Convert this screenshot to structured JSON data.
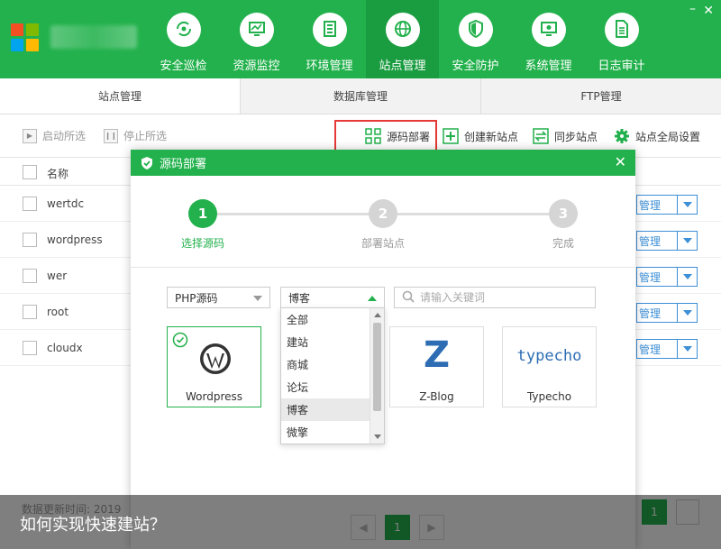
{
  "window": {
    "minimize_glyph": "–",
    "close_glyph": "✕"
  },
  "nav": [
    {
      "label": "安全巡检",
      "icon": "refresh-eye-icon"
    },
    {
      "label": "资源监控",
      "icon": "monitor-chart-icon"
    },
    {
      "label": "环境管理",
      "icon": "server-icon"
    },
    {
      "label": "站点管理",
      "icon": "globe-icon",
      "active": true
    },
    {
      "label": "安全防护",
      "icon": "shield-icon"
    },
    {
      "label": "系统管理",
      "icon": "settings-monitor-icon"
    },
    {
      "label": "日志审计",
      "icon": "document-icon"
    }
  ],
  "tabs": [
    "站点管理",
    "数据库管理",
    "FTP管理"
  ],
  "toolbar": {
    "start_selected": "启动所选",
    "stop_selected": "停止所选",
    "deploy_source": "源码部署",
    "create_site": "创建新站点",
    "sync_sites": "同步站点",
    "global_settings": "站点全局设置"
  },
  "table": {
    "header_name": "名称",
    "rows": [
      "wertdc",
      "wordpress",
      "wer",
      "root",
      "cloudx"
    ],
    "manage_label": "管理"
  },
  "footer": {
    "update_time": "数据更新时间: 2019",
    "page": "1"
  },
  "dialog": {
    "title": "源码部署",
    "close_glyph": "✕",
    "steps": [
      {
        "num": "1",
        "label": "选择源码"
      },
      {
        "num": "2",
        "label": "部署站点"
      },
      {
        "num": "3",
        "label": "完成"
      }
    ],
    "language_select": "PHP源码",
    "category_select": "博客",
    "search_placeholder": "请输入关键词",
    "category_options": [
      "全部",
      "建站",
      "商城",
      "论坛",
      "博客",
      "微擎"
    ],
    "selected_option": "博客",
    "cards": [
      "Wordpress",
      "Z-Blog",
      "Typecho"
    ],
    "typecho_logo_text": "typecho",
    "zblog_logo_text": "Z",
    "page": "1"
  },
  "caption": "如何实现快速建站？",
  "colors": {
    "brand_green": "#22b14c",
    "active_green": "#1a9c40",
    "link_blue": "#3d8fd6",
    "highlight_red": "#e53935"
  }
}
